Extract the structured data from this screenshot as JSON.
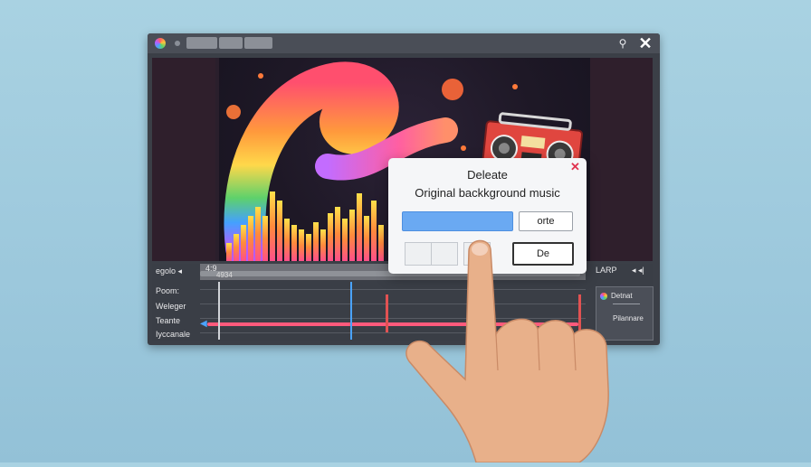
{
  "window": {
    "title_buttons": [
      "",
      "",
      ""
    ],
    "icons": {
      "logo": "app-logo-icon",
      "search": "search-icon",
      "close": "close-icon"
    },
    "search_glyph": "⚲",
    "close_glyph": "✕"
  },
  "timeline": {
    "track_header": "egolo ◂",
    "labels": [
      "Poom:",
      "Weleger",
      "Teante",
      "Iyccanale"
    ],
    "ruler_value": "4:9",
    "ruler_sub": "4934",
    "right_top": "LARP",
    "right_ctrl": "◂ ◂|",
    "panel_item": "Detnat",
    "panel_sub": "Pilannare"
  },
  "dialog": {
    "title": "Deleate",
    "subtitle": "Original backkground music",
    "close_glyph": "✕",
    "input_value": "",
    "button_top": "orte",
    "button_bottom": "De"
  },
  "colors": {
    "accent": "#4d8fe0",
    "danger": "#e0334f",
    "wave": "#ff5a7c"
  }
}
